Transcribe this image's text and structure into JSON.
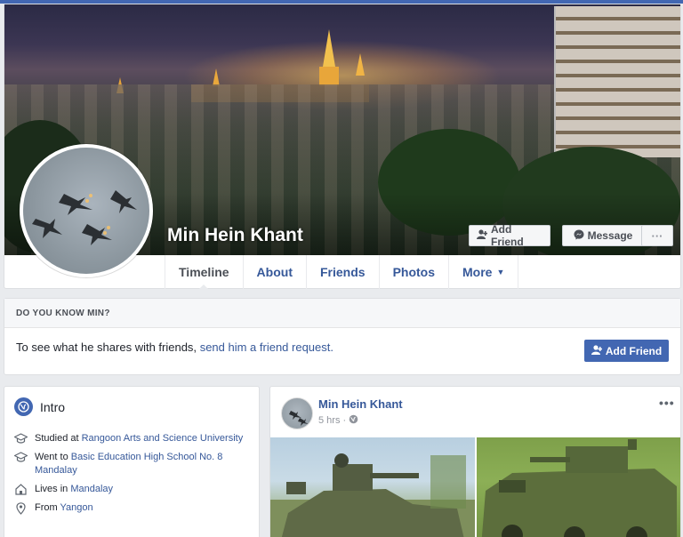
{
  "profile": {
    "name": "Min Hein Khant"
  },
  "cover_buttons": {
    "add_friend": "Add Friend",
    "message": "Message",
    "more": "···"
  },
  "tabs": [
    {
      "label": "Timeline",
      "active": true
    },
    {
      "label": "About"
    },
    {
      "label": "Friends"
    },
    {
      "label": "Photos"
    },
    {
      "label": "More"
    }
  ],
  "know_card": {
    "heading": "DO YOU KNOW MIN?",
    "text": "To see what he shares with friends,",
    "link": "send him a friend request.",
    "button": "Add Friend"
  },
  "intro": {
    "title": "Intro",
    "items": [
      {
        "icon": "graduation-cap-icon",
        "prefix": "Studied at ",
        "link": "Rangoon Arts and Science University"
      },
      {
        "icon": "graduation-cap-icon",
        "prefix": "Went to ",
        "link": "Basic Education High School No. 8 Mandalay"
      },
      {
        "icon": "home-icon",
        "prefix": "Lives in ",
        "link": "Mandalay"
      },
      {
        "icon": "location-pin-icon",
        "prefix": "From ",
        "link": "Yangon"
      }
    ]
  },
  "post": {
    "author": "Min Hein Khant",
    "time": "5 hrs",
    "separator": "·",
    "audience_icon": "globe-icon",
    "menu": "•••"
  },
  "colors": {
    "brand_blue": "#4267b2",
    "link_blue": "#365899",
    "background": "#e9ebee"
  }
}
